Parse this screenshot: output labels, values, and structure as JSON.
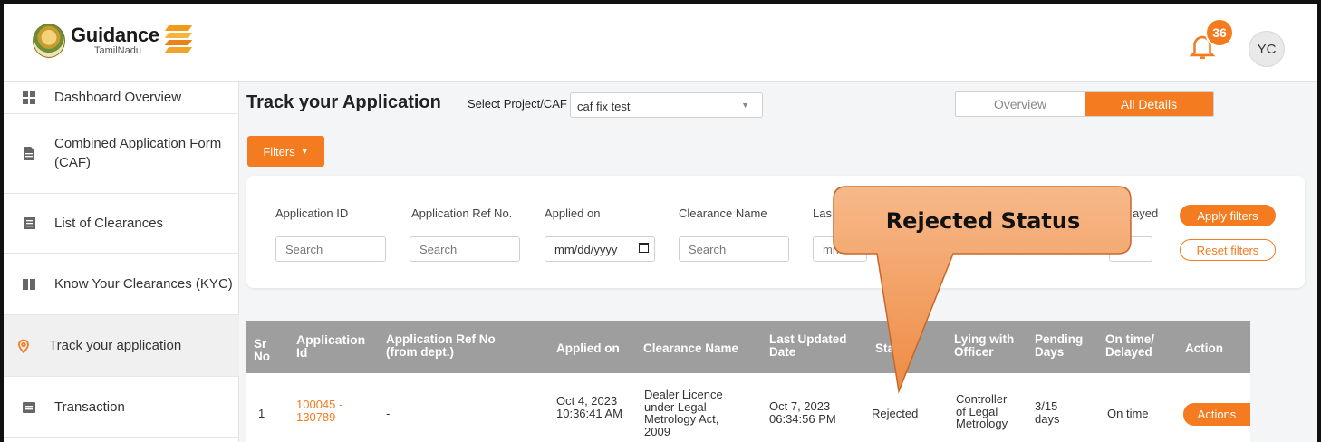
{
  "header": {
    "logo_title": "Guidance",
    "logo_sub": "TamilNadu",
    "notification_count": "36",
    "avatar_initials": "YC"
  },
  "sidebar": {
    "items": [
      {
        "label": "Dashboard Overview",
        "icon": "grid-icon"
      },
      {
        "label": "Combined Application Form (CAF)",
        "icon": "document-icon"
      },
      {
        "label": "List of Clearances",
        "icon": "list-icon"
      },
      {
        "label": "Know Your Clearances (KYC)",
        "icon": "book-icon"
      },
      {
        "label": "Track your application",
        "icon": "location-pin-icon",
        "active": true
      },
      {
        "label": "Transaction",
        "icon": "transaction-icon"
      }
    ]
  },
  "main": {
    "title": "Track your Application",
    "select_label": "Select Project/CAF",
    "select_value": "caf fix test",
    "toggle": {
      "overview": "Overview",
      "all_details": "All Details",
      "selected": "All Details"
    },
    "filters_button": "Filters",
    "filters": {
      "labels": [
        "Application ID",
        "Application Ref No.",
        "Applied on",
        "Clearance Name",
        "Las",
        "ayed"
      ],
      "placeholders": [
        "Search",
        "Search",
        "mm/dd/yyyy",
        "Search",
        "mm"
      ],
      "apply": "Apply filters",
      "reset": "Reset filters"
    }
  },
  "table": {
    "headers": {
      "sr": "Sr No",
      "app_id": "Application Id",
      "ref": "Application Ref No (from dept.)",
      "applied": "Applied on",
      "clearance": "Clearance Name",
      "updated": "Last Updated Date",
      "status": "Sta",
      "lying": "Lying with Officer",
      "pending": "Pending Days",
      "ontime": "On time/ Delayed",
      "action": "Action"
    },
    "rows": [
      {
        "sr": "1",
        "app_id": "100045 - 130789",
        "ref": "-",
        "applied": "Oct 4, 2023 10:36:41 AM",
        "clearance": "Dealer Licence under Legal Metrology Act, 2009",
        "updated": "Oct 7, 2023 06:34:56 PM",
        "status": "Rejected",
        "lying": "Controller of Legal Metrology",
        "pending": "3/15 days",
        "ontime": "On time",
        "action": "Actions"
      }
    ]
  },
  "callout": {
    "text": "Rejected Status"
  },
  "colors": {
    "accent": "#f47b20",
    "table_header": "#9e9e9e"
  }
}
